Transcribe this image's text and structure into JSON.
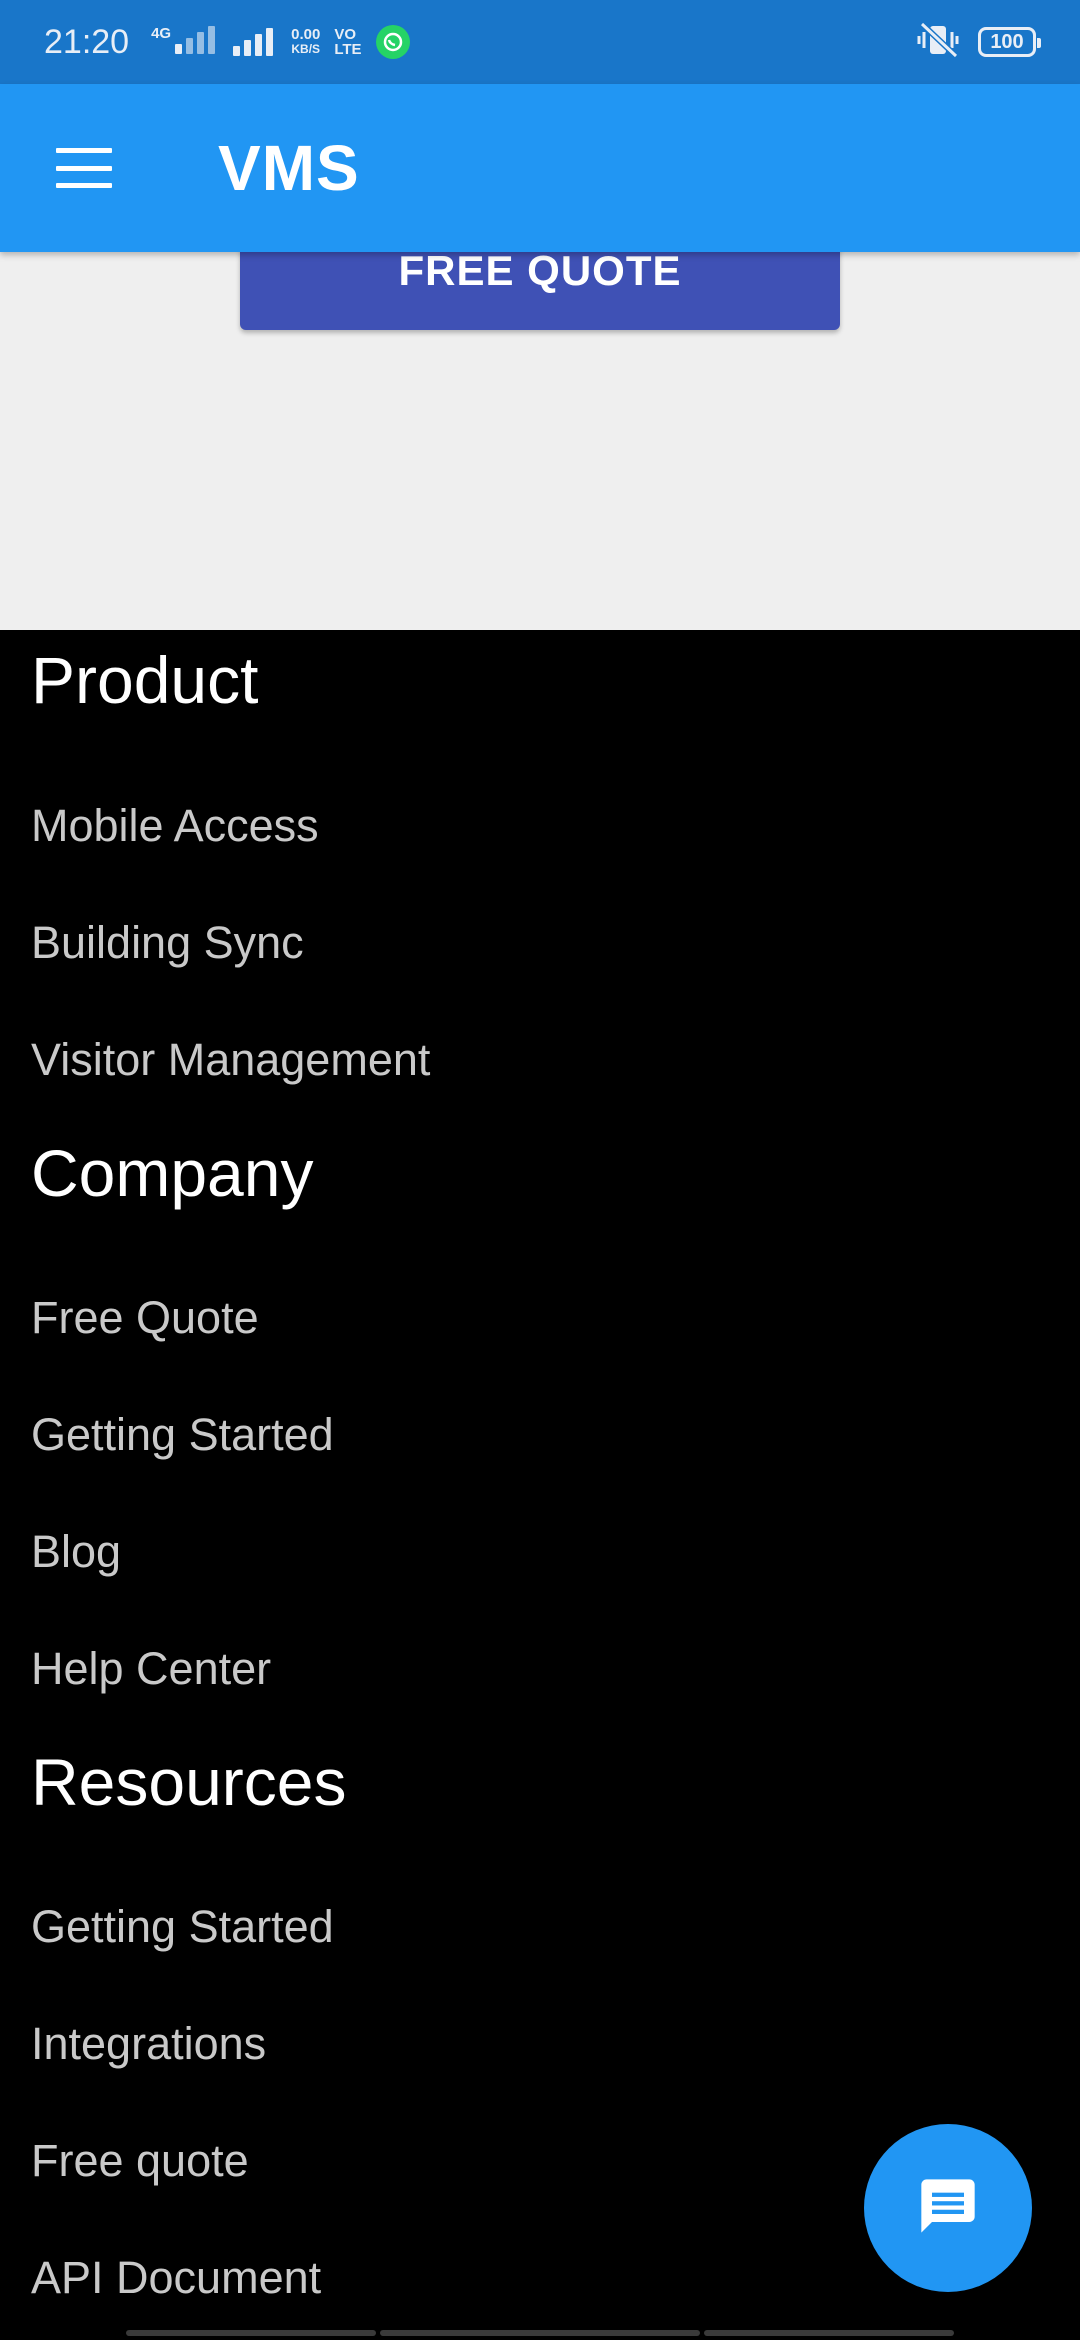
{
  "status_bar": {
    "time": "21:20",
    "net_type": "4G",
    "speed_value": "0.00",
    "speed_unit": "KB/S",
    "volte_top": "VO",
    "volte_bottom": "LTE",
    "battery": "100",
    "icons": [
      "signal-4g-icon",
      "signal-icon",
      "whatsapp-icon",
      "vibrate-icon",
      "battery-icon"
    ]
  },
  "app_bar": {
    "title": "VMS",
    "menu_icon": "hamburger-menu-icon"
  },
  "hero": {
    "quote_button_label": "FREE QUOTE"
  },
  "footer": {
    "product": {
      "title": "Product",
      "links": [
        "Mobile Access",
        "Building Sync",
        "Visitor Management"
      ]
    },
    "company": {
      "title": "Company",
      "links": [
        "Free Quote",
        "Getting Started",
        "Blog",
        "Help Center"
      ]
    },
    "resources": {
      "title": "Resources",
      "links": [
        "Getting Started",
        "Integrations",
        "Free quote",
        "API Document"
      ]
    }
  },
  "fab": {
    "icon": "chat-message-icon"
  },
  "colors": {
    "status_bar": "#1976c9",
    "app_bar": "#2196f3",
    "quote_button": "#3f51b5",
    "hero_bg": "#efefef",
    "footer_bg": "#000000",
    "fab": "#2196f3"
  }
}
